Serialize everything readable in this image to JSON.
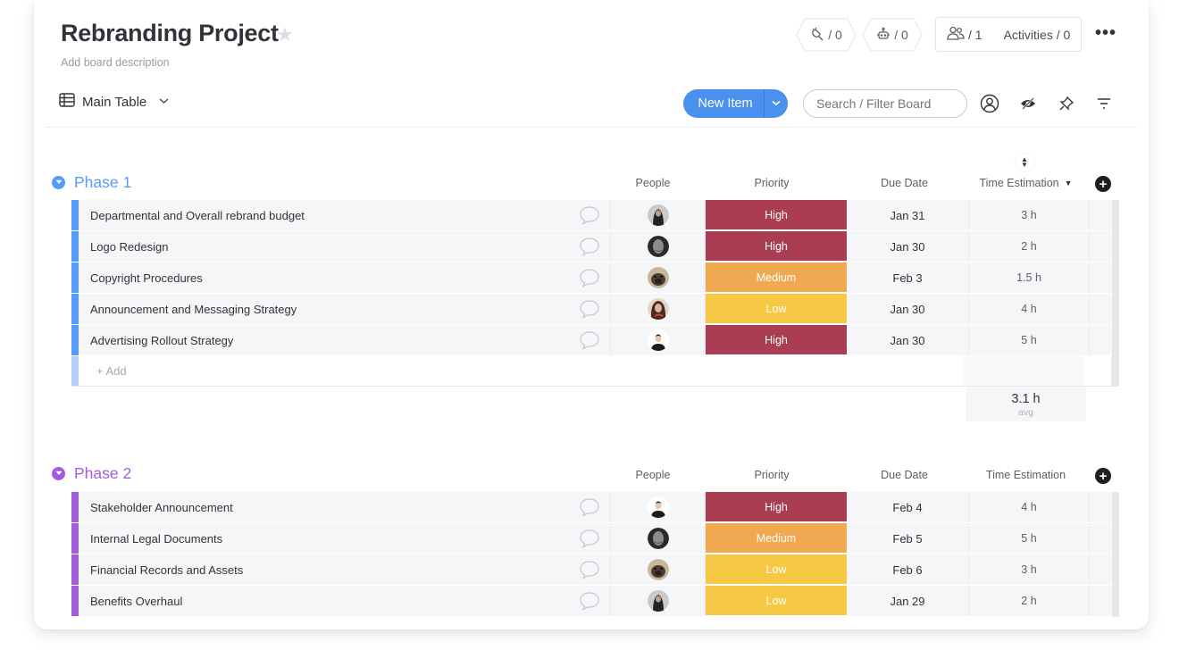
{
  "board": {
    "title": "Rebranding Project",
    "description_placeholder": "Add board description",
    "integrations_count": "/ 0",
    "automations_count": "/ 0",
    "members_count": "/ 1",
    "activities_label": "Activities / 0",
    "more_label": "•••"
  },
  "toolbar": {
    "view_label": "Main Table",
    "new_item_label": "New Item",
    "search_placeholder": "Search / Filter Board"
  },
  "colors": {
    "high": "#ab3d53",
    "medium": "#f0a950",
    "low": "#f6c843",
    "phase1": "#579bfc",
    "phase2": "#a25ddc",
    "primary": "#4a90ee"
  },
  "columns": {
    "people": "People",
    "priority": "Priority",
    "due_date": "Due Date",
    "time_estimation": "Time Estimation"
  },
  "groups": [
    {
      "title": "Phase 1",
      "add_label": "+ Add",
      "summary_value": "3.1 h",
      "summary_label": "avg",
      "items": [
        {
          "name": "Departmental and Overall rebrand budget",
          "priority": "High",
          "due": "Jan 31",
          "time": "3 h",
          "avatar": "woman-dark-hair"
        },
        {
          "name": "Logo Redesign",
          "priority": "High",
          "due": "Jan 30",
          "time": "2 h",
          "avatar": "woman-bw"
        },
        {
          "name": "Copyright Procedures",
          "priority": "Medium",
          "due": "Feb 3",
          "time": "1.5 h",
          "avatar": "dog"
        },
        {
          "name": "Announcement and Messaging Strategy",
          "priority": "Low",
          "due": "Jan 30",
          "time": "4 h",
          "avatar": "woman-brunette"
        },
        {
          "name": "Advertising Rollout Strategy",
          "priority": "High",
          "due": "Jan 30",
          "time": "5 h",
          "avatar": "man"
        }
      ]
    },
    {
      "title": "Phase 2",
      "items": [
        {
          "name": "Stakeholder Announcement",
          "priority": "High",
          "due": "Feb 4",
          "time": "4 h",
          "avatar": "man"
        },
        {
          "name": "Internal Legal Documents",
          "priority": "Medium",
          "due": "Feb 5",
          "time": "5 h",
          "avatar": "woman-bw"
        },
        {
          "name": "Financial Records and Assets",
          "priority": "Low",
          "due": "Feb 6",
          "time": "3 h",
          "avatar": "dog"
        },
        {
          "name": "Benefits Overhaul",
          "priority": "Low",
          "due": "Jan 29",
          "time": "2 h",
          "avatar": "woman-dark-hair"
        }
      ]
    }
  ]
}
